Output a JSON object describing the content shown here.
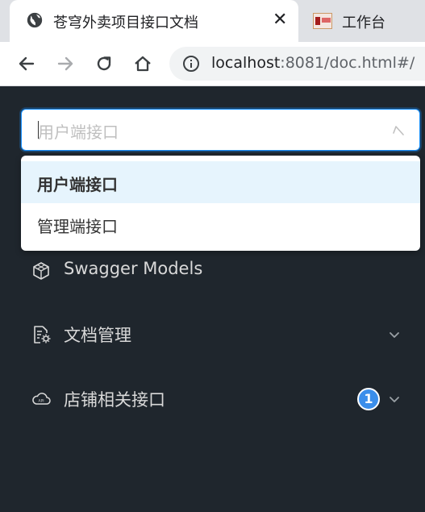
{
  "browser": {
    "active_tab": {
      "title": "苍穹外卖项目接口文档",
      "close": "✕"
    },
    "other_tab": {
      "title": "工作台"
    },
    "url": {
      "host": "localhost",
      "rest": ":8081/doc.html#/"
    }
  },
  "sidebar": {
    "group_select": {
      "placeholder": "用户端接口",
      "options": [
        {
          "label": "用户端接口",
          "selected": true
        },
        {
          "label": "管理端接口",
          "selected": false
        }
      ]
    },
    "menu": [
      {
        "label": "Swagger Models",
        "icon": "cube-icon"
      },
      {
        "label": "文档管理",
        "icon": "document-settings-icon",
        "expandable": true
      },
      {
        "label": "店铺相关接口",
        "icon": "cloud-api-icon",
        "expandable": true,
        "badge": "1"
      }
    ]
  },
  "colors": {
    "sidebar_bg": "#1f262d",
    "accent": "#1890ff",
    "badge": "#3b8eea",
    "selected_option_bg": "#e6f4fd"
  }
}
